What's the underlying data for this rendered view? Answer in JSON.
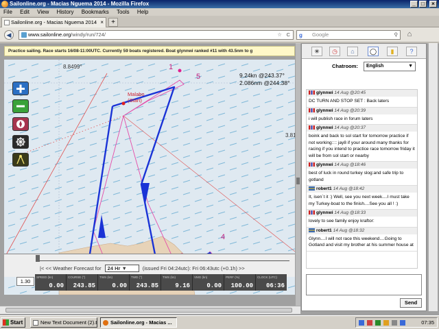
{
  "window": {
    "title": "Sailonline.org - Macias Nguema 2014 - Mozilla Firefox",
    "minimize": "_",
    "maximize": "□",
    "close": "×"
  },
  "menu": [
    "File",
    "Edit",
    "View",
    "History",
    "Bookmarks",
    "Tools",
    "Help"
  ],
  "tab": {
    "label": "Sailonline.org - Macias Nguema 2014",
    "close": "×",
    "new_tab": "+"
  },
  "nav": {
    "back": "◀",
    "url_host": "www.sailonline.org",
    "url_path": "/windy/run/724/",
    "star": "☆",
    "reload": "C",
    "search_engine": "g",
    "search_placeholder": "Google",
    "search_icon": "⚲",
    "home": "⌂"
  },
  "race": {
    "info": "Practice sailing. Race starts 16/08-11:00UTC. Currently 59 boats registered. Boat glynnwi ranked #11 with 43.5nm to g"
  },
  "map": {
    "lat_label": "8.8499°",
    "lon_label": "3.81",
    "speed_line1": "9.24kn @243.37°",
    "speed_line2": "2.086nm @244.38°",
    "start_name": "Malabo",
    "start_sub": "(Start)",
    "marks": [
      "1",
      "2",
      "3",
      "4",
      "5"
    ]
  },
  "weather": {
    "prefix": "|<  <<  Weather Forecast for",
    "range": "24 Hr",
    "issued": "(issued Fri 04:24utc): Fri 06:43utc (+0.1h)  >>",
    "zoom": "1.30"
  },
  "instruments": [
    {
      "label": "SPEED (kn)",
      "value": "0.00"
    },
    {
      "label": "COURSE (°)",
      "value": "243.85"
    },
    {
      "label": "TWS (kn)",
      "value": "0.00"
    },
    {
      "label": "TWD (°)",
      "value": "243.85"
    },
    {
      "label": "TWS (kn)",
      "value": "9.16"
    },
    {
      "label": "VMG (kn)",
      "value": "0.00"
    },
    {
      "label": "PERF (%)",
      "value": "100.00"
    },
    {
      "label": "CLOCK (UTC)",
      "value": "06:36"
    }
  ],
  "panel": {
    "chatroom_label": "Chatroom:",
    "chatroom_value": "English",
    "send_label": "Send"
  },
  "messages": [
    {
      "flag": "gb",
      "user": "glynnwi",
      "time": "14 Aug @20:45",
      "text": "DC TURN AND STOP SET : Back laters"
    },
    {
      "flag": "gb",
      "user": "glynnwi",
      "time": "14 Aug @20:39",
      "text": "i will publish race in forum laters"
    },
    {
      "flag": "gb",
      "user": "glynnwi",
      "time": "14 Aug @20:37",
      "text": "boink and back to sol start for tomorrow practice if not working:::: jay8 if your around many thanks for racing if you intend to practice race tomorrow friday it will be from sol start or nearby"
    },
    {
      "flag": "gb",
      "user": "glynnwi",
      "time": "14 Aug @18:46",
      "text": "best of luck in round turkey slog:and safe trip to gotland"
    },
    {
      "flag": "se",
      "user": "robert1",
      "time": "14 Aug @18:42",
      "text": "It, isen´t it :) Well, see you next week....I must take my Turkey-boat to the finish....See you all ! :)"
    },
    {
      "flag": "gb",
      "user": "glynnwi",
      "time": "14 Aug @18:33",
      "text": "lovely to see family enjoy kraftor:"
    },
    {
      "flag": "se",
      "user": "robert1",
      "time": "14 Aug @18:32",
      "text": "Glynn....I will not race this weekend....Going to Gotland and visit my brother at his summer house at"
    }
  ],
  "taskbar": {
    "start": "Start",
    "items": [
      "New Text Document (2).t...",
      "Sailonline.org - Macias ..."
    ],
    "clock": "07:35"
  },
  "colors": {
    "track": "#1a33d6",
    "route": "#e44aa8",
    "land": "#e7d3b8",
    "water": "#dfe9f1"
  }
}
